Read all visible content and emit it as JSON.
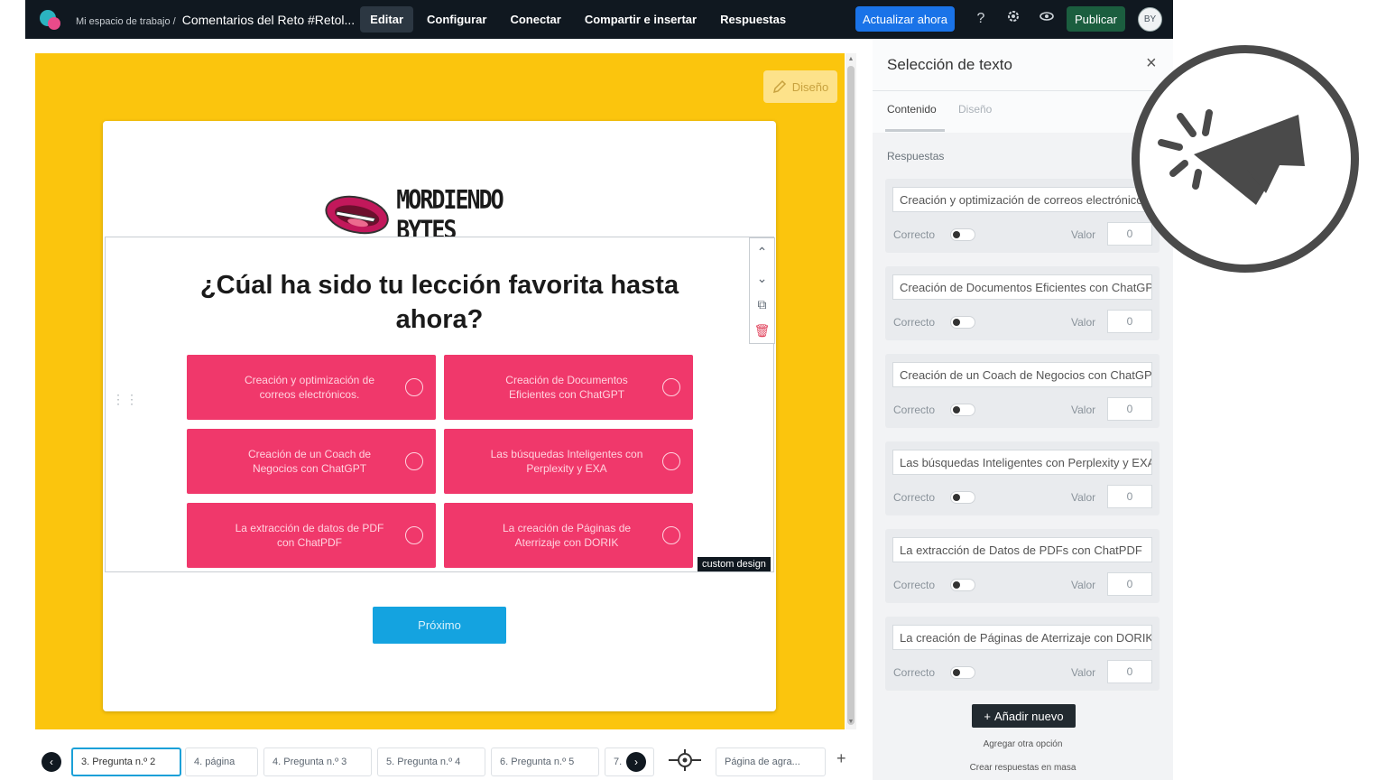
{
  "topbar": {
    "workspace": "Mi espacio de trabajo /",
    "form_title": "Comentarios del Reto #Retol...",
    "nav": [
      "Editar",
      "Configurar",
      "Conectar",
      "Compartir e insertar",
      "Respuestas"
    ],
    "update_label": "Actualizar ahora",
    "publish_label": "Publicar",
    "avatar_initials": "BY",
    "help_symbol": "?"
  },
  "canvas": {
    "design_label": "Diseño",
    "brand": "MORDIENDO BYTES",
    "question": "¿Cúal ha sido tu lección favorita hasta ahora?",
    "answers": [
      "Creación y optimización de correos electrónicos.",
      "Creación de Documentos Eficientes con ChatGPT",
      "Creación de un Coach de Negocios con ChatGPT",
      "Las búsquedas Inteligentes con Perplexity y EXA",
      "La extracción de datos de PDF con ChatPDF",
      "La creación de Páginas de Aterrizaje con DORIK"
    ],
    "custom_tag": "custom design",
    "next_label": "Próximo"
  },
  "pages": {
    "tabs": [
      "3. Pregunta n.º 2",
      "4. página",
      "4. Pregunta n.º 3",
      "5. Pregunta n.º 4",
      "6. Pregunta n.º 5",
      "7."
    ],
    "ending": "Página de agra..."
  },
  "panel": {
    "title": "Selección de texto",
    "tab_content": "Contenido",
    "tab_design": "Diseño",
    "section": "Respuestas",
    "correct_label": "Correcto",
    "value_label": "Valor",
    "options": [
      {
        "text": "Creación y optimización de correos electrónicos.",
        "value": "0"
      },
      {
        "text": "Creación de Documentos Eficientes con ChatGPT",
        "value": "0"
      },
      {
        "text": "Creación de un Coach de Negocios con ChatGPT",
        "value": "0"
      },
      {
        "text": "Las búsquedas Inteligentes con Perplexity y EXA",
        "value": "0"
      },
      {
        "text": "La extracción de Datos de PDFs con ChatPDF",
        "value": "0"
      },
      {
        "text": "La creación de Páginas de Aterrizaje con DORIK",
        "value": "0"
      }
    ],
    "add_label": "Añadir nuevo",
    "add_other": "Agregar otra opción",
    "bulk": "Crear respuestas en masa"
  },
  "colors": {
    "canvas_bg": "#fbc50d",
    "answer_bg": "#f0386b",
    "next_bg": "#14a3e0",
    "update_bg": "#1a73e8",
    "publish_bg": "#1b5e3f",
    "topbar_bg": "#101820"
  },
  "icons": {
    "cursor_badge": "cursor-click-icon"
  }
}
